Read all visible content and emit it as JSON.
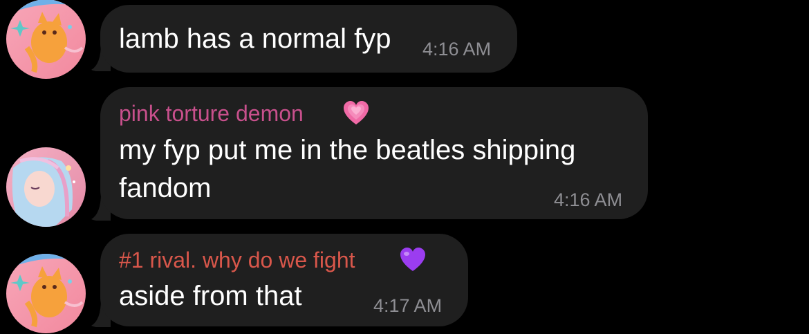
{
  "colors": {
    "background": "#000000",
    "bubble": "#1f1f1f",
    "text": "#ffffff",
    "timestamp": "#8e8e93",
    "sender_pink": "#c8508c",
    "sender_red": "#d9574b",
    "pink_heart": "#f06aa6",
    "purple_heart": "#9b3df0"
  },
  "messages": [
    {
      "text": "lamb has a normal fyp",
      "time": "4:16 AM",
      "avatar": "orange-cat-avatar"
    },
    {
      "sender": "pink torture demon",
      "sender_emoji": "growing-pink-heart-emoji",
      "lines": [
        "my fyp put me in the beatles shipping",
        "fandom"
      ],
      "time": "4:16 AM",
      "avatar": "anime-girl-avatar"
    },
    {
      "sender": "#1 rival. why do we fight",
      "sender_emoji": "purple-heart-emoji",
      "text": "aside from that",
      "time": "4:17 AM",
      "avatar": "orange-cat-avatar"
    }
  ]
}
